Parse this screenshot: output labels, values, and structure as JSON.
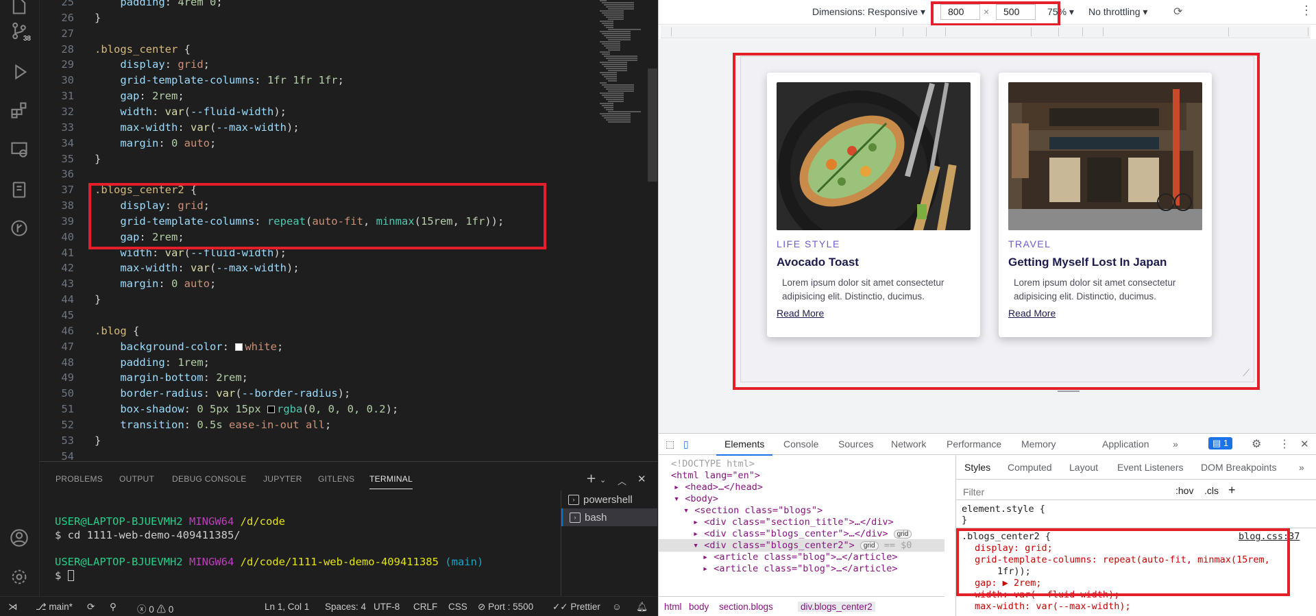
{
  "editor": {
    "lines": [
      {
        "n": "25",
        "parts": [
          [
            "pn",
            "    "
          ],
          [
            "prop",
            "padding"
          ],
          [
            "pn",
            ": "
          ],
          [
            "num",
            "4rem 0"
          ],
          [
            "pn",
            ";"
          ]
        ]
      },
      {
        "n": "26",
        "parts": [
          [
            "pn",
            "}"
          ]
        ]
      },
      {
        "n": "27",
        "parts": []
      },
      {
        "n": "28",
        "parts": [
          [
            "sel",
            ".blogs_center"
          ],
          [
            "pn",
            " {"
          ]
        ]
      },
      {
        "n": "29",
        "parts": [
          [
            "pn",
            "    "
          ],
          [
            "prop",
            "display"
          ],
          [
            "pn",
            ": "
          ],
          [
            "val",
            "grid"
          ],
          [
            "pn",
            ";"
          ]
        ]
      },
      {
        "n": "30",
        "parts": [
          [
            "pn",
            "    "
          ],
          [
            "prop",
            "grid-template-columns"
          ],
          [
            "pn",
            ": "
          ],
          [
            "num",
            "1fr 1fr 1fr"
          ],
          [
            "pn",
            ";"
          ]
        ]
      },
      {
        "n": "31",
        "parts": [
          [
            "pn",
            "    "
          ],
          [
            "prop",
            "gap"
          ],
          [
            "pn",
            ": "
          ],
          [
            "num",
            "2rem"
          ],
          [
            "pn",
            ";"
          ]
        ]
      },
      {
        "n": "32",
        "parts": [
          [
            "pn",
            "    "
          ],
          [
            "prop",
            "width"
          ],
          [
            "pn",
            ": "
          ],
          [
            "fn",
            "var"
          ],
          [
            "pn",
            "("
          ],
          [
            "vari",
            "--fluid-width"
          ],
          [
            "pn",
            ");"
          ]
        ]
      },
      {
        "n": "33",
        "parts": [
          [
            "pn",
            "    "
          ],
          [
            "prop",
            "max-width"
          ],
          [
            "pn",
            ": "
          ],
          [
            "fn",
            "var"
          ],
          [
            "pn",
            "("
          ],
          [
            "vari",
            "--max-width"
          ],
          [
            "pn",
            ");"
          ]
        ]
      },
      {
        "n": "34",
        "parts": [
          [
            "pn",
            "    "
          ],
          [
            "prop",
            "margin"
          ],
          [
            "pn",
            ": "
          ],
          [
            "num",
            "0"
          ],
          [
            "val",
            " auto"
          ],
          [
            "pn",
            ";"
          ]
        ]
      },
      {
        "n": "35",
        "parts": [
          [
            "pn",
            "}"
          ]
        ]
      },
      {
        "n": "36",
        "parts": []
      },
      {
        "n": "37",
        "parts": [
          [
            "sel",
            ".blogs_center2"
          ],
          [
            "pn",
            " {"
          ]
        ]
      },
      {
        "n": "38",
        "parts": [
          [
            "pn",
            "    "
          ],
          [
            "prop",
            "display"
          ],
          [
            "pn",
            ": "
          ],
          [
            "val",
            "grid"
          ],
          [
            "pn",
            ";"
          ]
        ]
      },
      {
        "n": "39",
        "parts": [
          [
            "pn",
            "    "
          ],
          [
            "prop",
            "grid-template-columns"
          ],
          [
            "pn",
            ": "
          ],
          [
            "kw",
            "repeat"
          ],
          [
            "pn",
            "("
          ],
          [
            "val",
            "auto-fit"
          ],
          [
            "pn",
            ", "
          ],
          [
            "kw",
            "minmax"
          ],
          [
            "pn",
            "("
          ],
          [
            "num",
            "15rem"
          ],
          [
            "pn",
            ", "
          ],
          [
            "num",
            "1fr"
          ],
          [
            "pn",
            "));"
          ]
        ]
      },
      {
        "n": "40",
        "parts": [
          [
            "pn",
            "    "
          ],
          [
            "prop",
            "gap"
          ],
          [
            "pn",
            ": "
          ],
          [
            "num",
            "2rem"
          ],
          [
            "pn",
            ";"
          ]
        ]
      },
      {
        "n": "41",
        "parts": [
          [
            "pn",
            "    "
          ],
          [
            "prop",
            "width"
          ],
          [
            "pn",
            ": "
          ],
          [
            "fn",
            "var"
          ],
          [
            "pn",
            "("
          ],
          [
            "vari",
            "--fluid-width"
          ],
          [
            "pn",
            ");"
          ]
        ]
      },
      {
        "n": "42",
        "parts": [
          [
            "pn",
            "    "
          ],
          [
            "prop",
            "max-width"
          ],
          [
            "pn",
            ": "
          ],
          [
            "fn",
            "var"
          ],
          [
            "pn",
            "("
          ],
          [
            "vari",
            "--max-width"
          ],
          [
            "pn",
            ");"
          ]
        ]
      },
      {
        "n": "43",
        "parts": [
          [
            "pn",
            "    "
          ],
          [
            "prop",
            "margin"
          ],
          [
            "pn",
            ": "
          ],
          [
            "num",
            "0"
          ],
          [
            "val",
            " auto"
          ],
          [
            "pn",
            ";"
          ]
        ]
      },
      {
        "n": "44",
        "parts": [
          [
            "pn",
            "}"
          ]
        ]
      },
      {
        "n": "45",
        "parts": []
      },
      {
        "n": "46",
        "parts": [
          [
            "sel",
            ".blog"
          ],
          [
            "pn",
            " {"
          ]
        ]
      },
      {
        "n": "47",
        "parts": [
          [
            "pn",
            "    "
          ],
          [
            "prop",
            "background-color"
          ],
          [
            "pn",
            ": "
          ],
          [
            "swatch",
            "#ffffff"
          ],
          [
            "val",
            "white"
          ],
          [
            "pn",
            ";"
          ]
        ]
      },
      {
        "n": "48",
        "parts": [
          [
            "pn",
            "    "
          ],
          [
            "prop",
            "padding"
          ],
          [
            "pn",
            ": "
          ],
          [
            "num",
            "1rem"
          ],
          [
            "pn",
            ";"
          ]
        ]
      },
      {
        "n": "49",
        "parts": [
          [
            "pn",
            "    "
          ],
          [
            "prop",
            "margin-bottom"
          ],
          [
            "pn",
            ": "
          ],
          [
            "num",
            "2rem"
          ],
          [
            "pn",
            ";"
          ]
        ]
      },
      {
        "n": "50",
        "parts": [
          [
            "pn",
            "    "
          ],
          [
            "prop",
            "border-radius"
          ],
          [
            "pn",
            ": "
          ],
          [
            "fn",
            "var"
          ],
          [
            "pn",
            "("
          ],
          [
            "vari",
            "--border-radius"
          ],
          [
            "pn",
            ");"
          ]
        ]
      },
      {
        "n": "51",
        "parts": [
          [
            "pn",
            "    "
          ],
          [
            "prop",
            "box-shadow"
          ],
          [
            "pn",
            ": "
          ],
          [
            "num",
            "0 5px 15px "
          ],
          [
            "swatch",
            "#000000"
          ],
          [
            "kw",
            "rgba"
          ],
          [
            "pn",
            "("
          ],
          [
            "num",
            "0, 0, 0, 0.2"
          ],
          [
            "pn",
            ");"
          ]
        ]
      },
      {
        "n": "52",
        "parts": [
          [
            "pn",
            "    "
          ],
          [
            "prop",
            "transition"
          ],
          [
            "pn",
            ": "
          ],
          [
            "num",
            "0.5s"
          ],
          [
            "val",
            " ease-in-out all"
          ],
          [
            "pn",
            ";"
          ]
        ]
      },
      {
        "n": "53",
        "parts": [
          [
            "pn",
            "}"
          ]
        ]
      },
      {
        "n": "54",
        "parts": []
      }
    ],
    "scm_badge": "38"
  },
  "panel": {
    "tabs": [
      "PROBLEMS",
      "OUTPUT",
      "DEBUG CONSOLE",
      "JUPYTER",
      "GITLENS",
      "TERMINAL"
    ],
    "terminals": [
      "powershell",
      "bash"
    ],
    "term1_user": "USER@LAPTOP-BJUEVMH2",
    "term1_env": "MINGW64",
    "term1_path": "/d/code",
    "term2_cmd": "$ cd 1111-web-demo-409411385/",
    "term3_user": "USER@LAPTOP-BJUEVMH2",
    "term3_env": "MINGW64",
    "term3_path": "/d/code/1111-web-demo-409411385",
    "term3_branch": "(main)",
    "term4_prompt": "$"
  },
  "statusbar": {
    "branch": "main*",
    "errors": "0",
    "warnings": "0",
    "position": "Ln 1, Col 1",
    "spaces": "Spaces: 4",
    "encoding": "UTF-8",
    "eol": "CRLF",
    "language": "CSS",
    "port": "Port : 5500",
    "prettier": "Prettier"
  },
  "device_toolbar": {
    "dimensions_label": "Dimensions: Responsive",
    "width": "800",
    "height": "500",
    "times": "×",
    "zoom": "75%",
    "throttling": "No throttling"
  },
  "cards": [
    {
      "category": "LIFE STYLE",
      "title": "Avocado Toast",
      "text": "Lorem ipsum dolor sit amet consectetur adipisicing elit. Distinctio, ducimus.",
      "link": "Read More"
    },
    {
      "category": "TRAVEL",
      "title": "Getting Myself Lost In Japan",
      "text": "Lorem ipsum dolor sit amet consectetur adipisicing elit. Distinctio, ducimus.",
      "link": "Read More"
    }
  ],
  "devtools": {
    "tabs": [
      "Elements",
      "Console",
      "Sources",
      "Network",
      "Performance",
      "Memory",
      "Application"
    ],
    "issues_count": "1",
    "styles_tabs": [
      "Styles",
      "Computed",
      "Layout",
      "Event Listeners",
      "DOM Breakpoints"
    ],
    "filter_placeholder": "Filter",
    "hov": ":hov",
    "cls": ".cls",
    "element_style": "element.style {",
    "close_brace": "}",
    "rule_selector": ".blogs_center2 {",
    "rule_source": "blog.css:37",
    "rule_display": "display: grid;",
    "rule_gtc": "grid-template-columns: repeat(auto-fit, minmax(15rem,",
    "rule_gtc2": "1fr));",
    "rule_gap": "gap: ▶ 2rem;",
    "rule_width": "width: var(--fluid-width);",
    "rule_maxwidth": "max-width: var(--max-width);",
    "breadcrumbs": [
      "html",
      "body",
      "section.blogs",
      "div.blogs_center2"
    ],
    "dom": {
      "doctype": "<!DOCTYPE html>",
      "html_open": "<html lang=\"en\">",
      "head": "<head>…</head>",
      "body_open": "<body>",
      "section": "<section class=\"blogs\">",
      "div1": "<div class=\"section_title\">…</div>",
      "div2": "<div class=\"blogs_center\">…</div>",
      "div3": "<div class=\"blogs_center2\">",
      "selected_marker": "== $0",
      "article1": "<article class=\"blog\">…</article>",
      "article2": "<article class=\"blog\">…</article>",
      "grid_badge": "grid"
    }
  }
}
